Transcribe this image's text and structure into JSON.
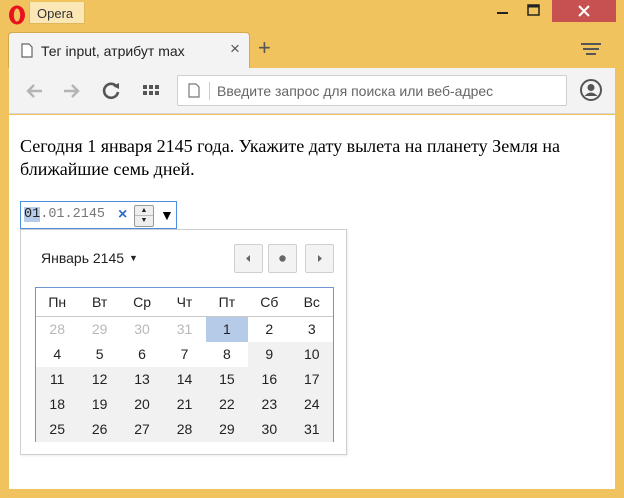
{
  "window": {
    "app_name": "Opera",
    "colors": {
      "frame": "#f0c35e",
      "close": "#c75050",
      "accent": "#2e6fc9",
      "selection": "#b5cbe8"
    }
  },
  "tab": {
    "title": "Тег input, атрибут max",
    "close_label": "×"
  },
  "new_tab_label": "+",
  "address": {
    "placeholder": "Введите запрос для поиска или веб-адрес",
    "value": ""
  },
  "page": {
    "intro": "Сегодня 1 января 2145 года. Укажите дату вылета на планету Земля на ближайшие семь дней."
  },
  "date_input": {
    "day": "01",
    "sep1": ".",
    "month": "01",
    "sep2": ".",
    "year": "2145",
    "clear_icon": "×",
    "spin_up": "▲",
    "spin_down": "▼",
    "dropdown_icon": "▼"
  },
  "calendar": {
    "month_label": "Январь 2145",
    "weekdays": [
      "Пн",
      "Вт",
      "Ср",
      "Чт",
      "Пт",
      "Сб",
      "Вс"
    ],
    "weeks": [
      [
        "28",
        "29",
        "30",
        "31",
        "1",
        "2",
        "3"
      ],
      [
        "4",
        "5",
        "6",
        "7",
        "8",
        "9",
        "10"
      ],
      [
        "11",
        "12",
        "13",
        "14",
        "15",
        "16",
        "17"
      ],
      [
        "18",
        "19",
        "20",
        "21",
        "22",
        "23",
        "24"
      ],
      [
        "25",
        "26",
        "27",
        "28",
        "29",
        "30",
        "31"
      ]
    ],
    "selected_day": "1"
  }
}
